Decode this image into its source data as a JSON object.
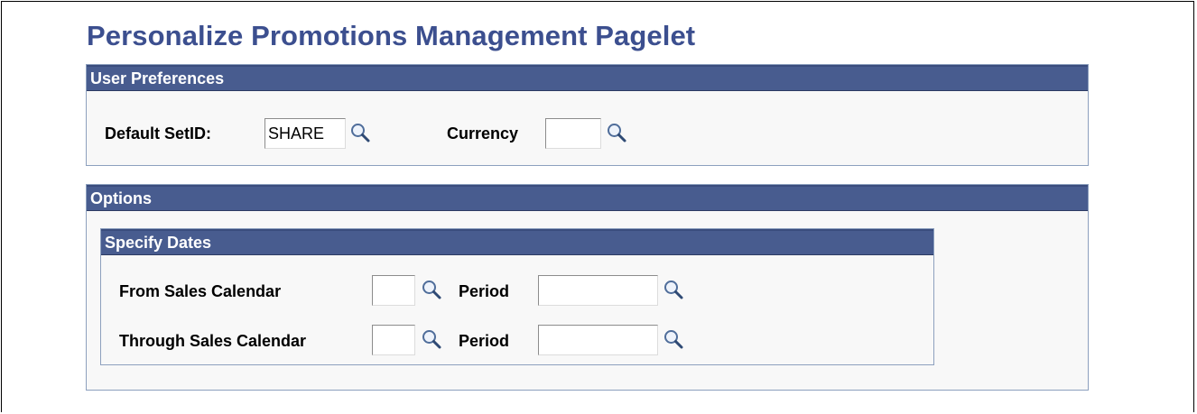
{
  "page": {
    "title": "Personalize Promotions Management Pagelet"
  },
  "user_preferences": {
    "header": "User Preferences",
    "default_setid_label": "Default SetID:",
    "default_setid_value": "SHARE",
    "currency_label": "Currency",
    "currency_value": ""
  },
  "options": {
    "header": "Options",
    "specify_dates": {
      "header": "Specify Dates",
      "from_calendar_label": "From Sales Calendar",
      "from_calendar_value": "",
      "from_period_label": "Period",
      "from_period_value": "",
      "through_calendar_label": "Through Sales Calendar",
      "through_calendar_value": "",
      "through_period_label": "Period",
      "through_period_value": ""
    }
  },
  "icons": {
    "lookup": "magnifying-glass-icon"
  },
  "colors": {
    "title": "#3c4f8f",
    "header_bg": "#485c8f",
    "header_text": "#ffffff",
    "group_border": "#8da0be"
  }
}
